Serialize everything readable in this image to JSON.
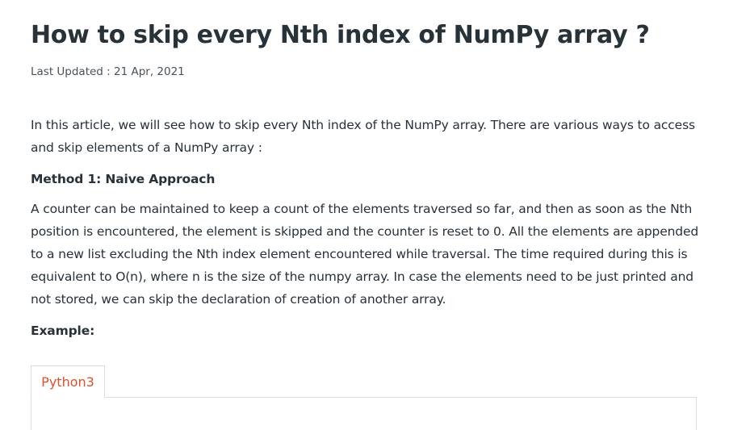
{
  "article": {
    "title": "How to skip every Nth index of NumPy array ?",
    "last_updated": "Last Updated : 21 Apr, 2021",
    "intro": "In this article, we will see how to skip every Nth index of the NumPy array. There are various ways to access and skip elements of a NumPy array :",
    "method1_heading": "Method 1: Naive Approach",
    "method1_body": "A counter can be maintained to keep a count of the elements traversed so far, and then as soon as the Nth position is encountered, the element is skipped and the counter is reset to 0. All the elements are appended to a new list excluding the Nth index element encountered while traversal. The time required during this is equivalent to O(n), where n is the size of the numpy array. In case the elements need to be just printed and not stored, we can skip the declaration of creation of another array.",
    "example_heading": "Example:"
  },
  "code_tabs": {
    "active_tab": "Python3"
  },
  "colors": {
    "text": "#273239",
    "tab_accent": "#e0502a"
  }
}
